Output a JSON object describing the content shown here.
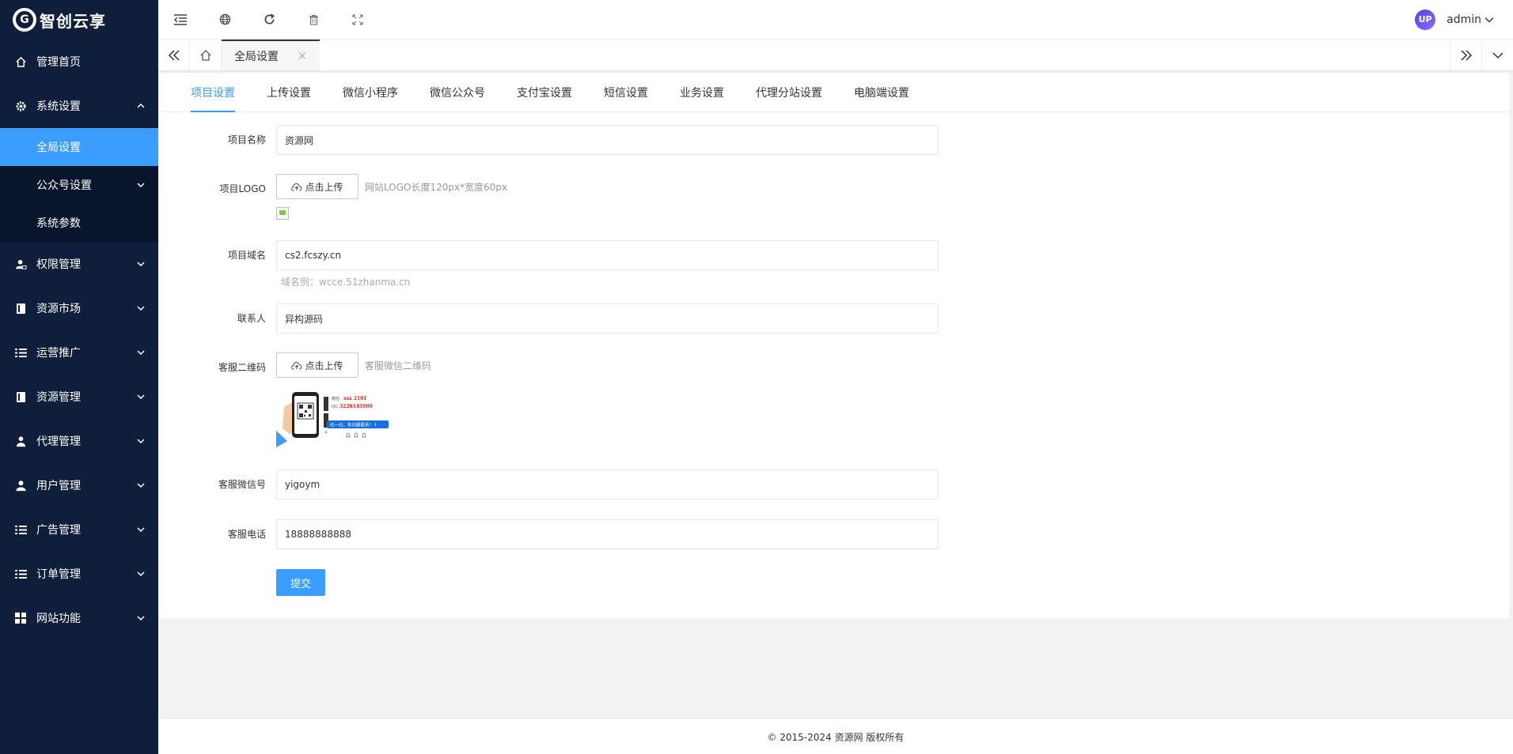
{
  "brand": {
    "logo_mark": "G",
    "name": "智创云享"
  },
  "sidebar": {
    "items": [
      {
        "label": "管理首页",
        "icon": "home-icon"
      },
      {
        "label": "系统设置",
        "icon": "gear-icon",
        "expanded": true,
        "children": [
          {
            "label": "全局设置",
            "active": true
          },
          {
            "label": "公众号设置",
            "has_children": true
          },
          {
            "label": "系统参数"
          }
        ]
      },
      {
        "label": "权限管理",
        "icon": "user-lock-icon"
      },
      {
        "label": "资源市场",
        "icon": "book-icon"
      },
      {
        "label": "运营推广",
        "icon": "list-icon"
      },
      {
        "label": "资源管理",
        "icon": "book-icon"
      },
      {
        "label": "代理管理",
        "icon": "agent-icon"
      },
      {
        "label": "用户管理",
        "icon": "user-icon"
      },
      {
        "label": "广告管理",
        "icon": "list-icon"
      },
      {
        "label": "订单管理",
        "icon": "list-icon"
      },
      {
        "label": "网站功能",
        "icon": "grid-icon"
      }
    ]
  },
  "header": {
    "user": {
      "avatar_text": "UP",
      "name": "admin"
    }
  },
  "tabbar": {
    "active_tab": "全局设置",
    "close_glyph": "×"
  },
  "subtabs": [
    "项目设置",
    "上传设置",
    "微信小程序",
    "微信公众号",
    "支付宝设置",
    "短信设置",
    "业务设置",
    "代理分站设置",
    "电脑端设置"
  ],
  "form": {
    "project_name": {
      "label": "项目名称",
      "value": "资源网"
    },
    "project_logo": {
      "label": "项目LOGO",
      "upload_label": "点击上传",
      "hint": "网站LOGO长度120px*宽度60px"
    },
    "project_domain": {
      "label": "项目域名",
      "value": "cs2.fcszy.cn",
      "hint": "域名例：wcce.51zhanma.cn"
    },
    "contact": {
      "label": "联系人",
      "value": "异构源码"
    },
    "service_qrcode": {
      "label": "客服二维码",
      "upload_label": "点击上传",
      "hint": "客服微信二维码",
      "image_text": {
        "line1_prefix": "微信：",
        "line1": "xxx 2101",
        "line2_prefix": "QQ：",
        "line2": "3226145980",
        "banner": "扫一扫，有问题联系！↑"
      }
    },
    "service_wechat": {
      "label": "客服微信号",
      "value": "yigoym"
    },
    "service_phone": {
      "label": "客服电话",
      "value": "18888888888"
    },
    "submit_label": "提交"
  },
  "footer": {
    "text": "© 2015-2024 资源网 版权所有"
  },
  "colors": {
    "sidebar_bg": "#0f1e3a",
    "accent": "#3b9dff"
  }
}
